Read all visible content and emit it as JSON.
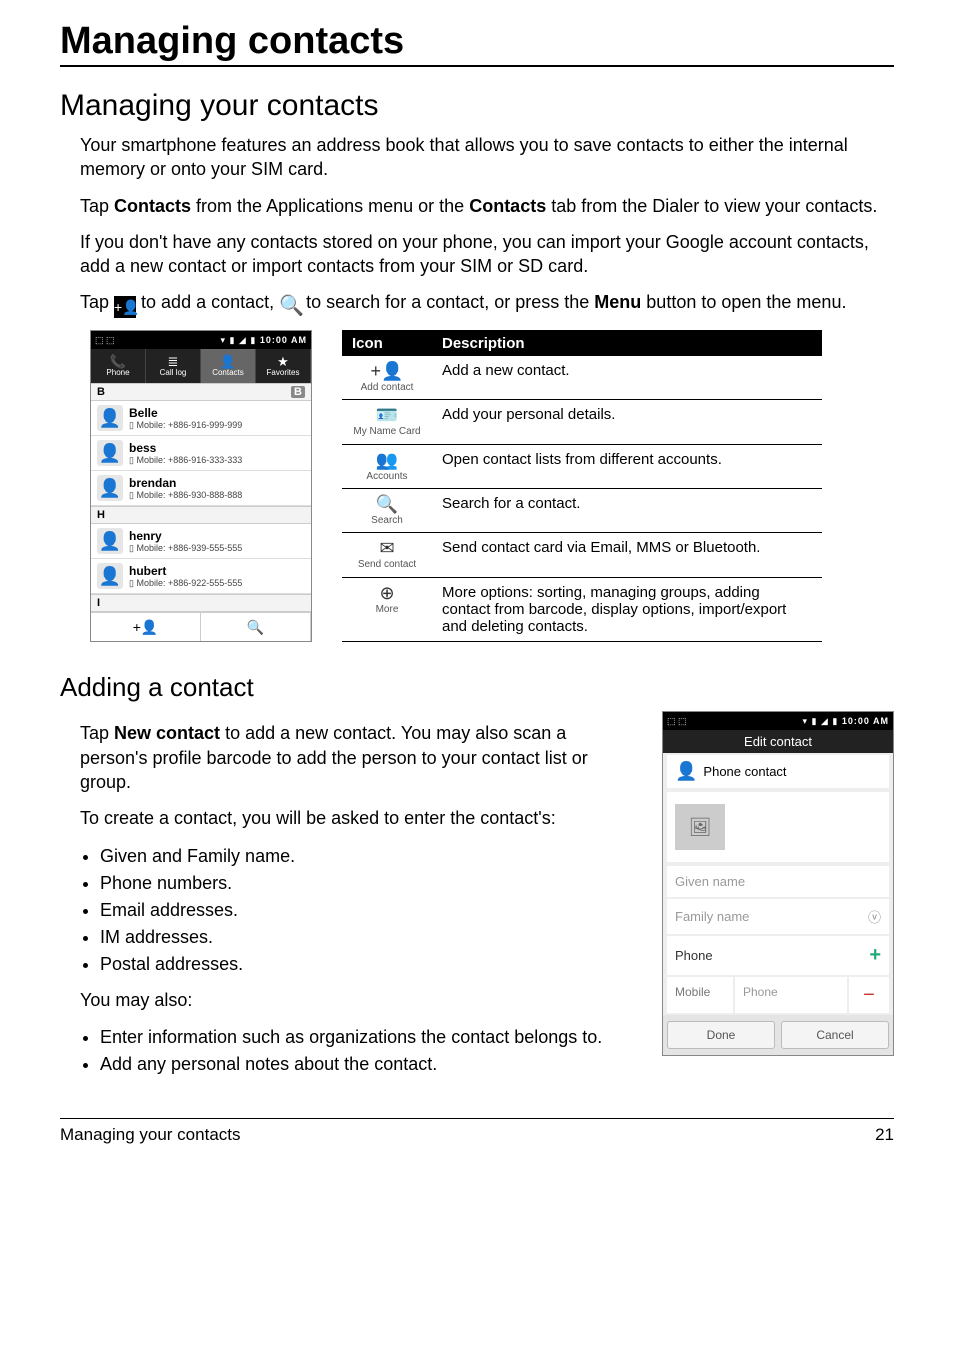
{
  "page": {
    "main_title": "Managing contacts",
    "section_title": "Managing your contacts",
    "sub_title": "Adding a contact",
    "footer_left": "Managing your contacts",
    "footer_right": "21"
  },
  "body": {
    "p1": "Your smartphone features an address book that allows you to save contacts to either the internal memory or onto your SIM card.",
    "p2a": "Tap ",
    "p2b_bold": "Contacts",
    "p2c": " from the Applications menu or the ",
    "p2d_bold": "Contacts",
    "p2e": " tab from the Dialer to view your contacts.",
    "p3": "If you don't have any contacts stored on your phone, you can import your Google account contacts, add a new contact or import contacts from your SIM or SD card.",
    "p4a": "Tap ",
    "p4b": " to add a contact, ",
    "p4c": " to search for a contact, or press the ",
    "p4d_bold": "Menu",
    "p4e": " button to open the menu."
  },
  "status_time": "10:00 AM",
  "contacts_screen": {
    "tabs": [
      "Phone",
      "Call log",
      "Contacts",
      "Favorites"
    ],
    "letter_b": "B",
    "letter_h": "H",
    "letter_i": "I",
    "contacts": [
      {
        "name": "Belle",
        "detail": "Mobile: +886-916-999-999"
      },
      {
        "name": "bess",
        "detail": "Mobile: +886-916-333-333"
      },
      {
        "name": "brendan",
        "detail": "Mobile: +886-930-888-888"
      },
      {
        "name": "henry",
        "detail": "Mobile: +886-939-555-555"
      },
      {
        "name": "hubert",
        "detail": "Mobile: +886-922-555-555"
      }
    ]
  },
  "table": {
    "head_icon": "Icon",
    "head_desc": "Description",
    "rows": [
      {
        "label": "Add contact",
        "desc": "Add a new contact."
      },
      {
        "label": "My Name Card",
        "desc": "Add your personal details."
      },
      {
        "label": "Accounts",
        "desc": "Open contact lists from different accounts."
      },
      {
        "label": "Search",
        "desc": "Search for a contact."
      },
      {
        "label": "Send contact",
        "desc": "Send contact card via Email, MMS or Bluetooth."
      },
      {
        "label": "More",
        "desc": "More options: sorting, managing groups, adding contact from barcode, display options, import/export and deleting contacts."
      }
    ]
  },
  "adding": {
    "p1a": "Tap ",
    "p1b_bold": "New contact",
    "p1c": " to add a new contact. You may also scan a person's profile barcode to add the person to your contact list or group.",
    "p2": "To create a contact, you will be asked to enter the contact's:",
    "bullets1": [
      "Given and Family name.",
      "Phone numbers.",
      "Email addresses.",
      "IM addresses.",
      "Postal addresses."
    ],
    "p3": "You may also:",
    "bullets2": [
      "Enter information such as organizations the contact belongs to.",
      "Add any personal notes about the contact."
    ]
  },
  "edit_screen": {
    "title": "Edit contact",
    "type": "Phone contact",
    "given": "Given name",
    "family": "Family name",
    "phone_label": "Phone",
    "mobile_label": "Mobile",
    "phone_placeholder": "Phone",
    "done": "Done",
    "cancel": "Cancel"
  }
}
